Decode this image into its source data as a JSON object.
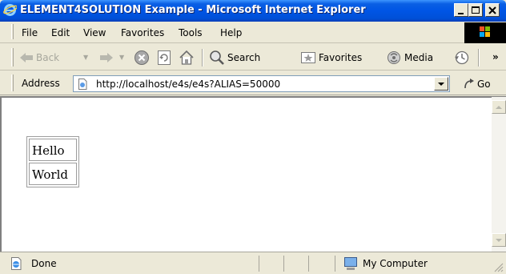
{
  "window": {
    "title": "ELEMENT4SOLUTION Example - Microsoft Internet Explorer"
  },
  "menu": {
    "items": [
      "File",
      "Edit",
      "View",
      "Favorites",
      "Tools",
      "Help"
    ]
  },
  "toolbar": {
    "back": "Back",
    "search": "Search",
    "favorites": "Favorites",
    "media": "Media",
    "more": "»"
  },
  "address": {
    "label": "Address",
    "value": "http://localhost/e4s/e4s?ALIAS=50000",
    "go": "Go"
  },
  "page": {
    "rows": [
      "Hello",
      "World"
    ]
  },
  "status": {
    "text": "Done",
    "zone": "My Computer"
  },
  "colors": {
    "titlebar": "#0055e5",
    "chrome": "#ece9d8"
  }
}
